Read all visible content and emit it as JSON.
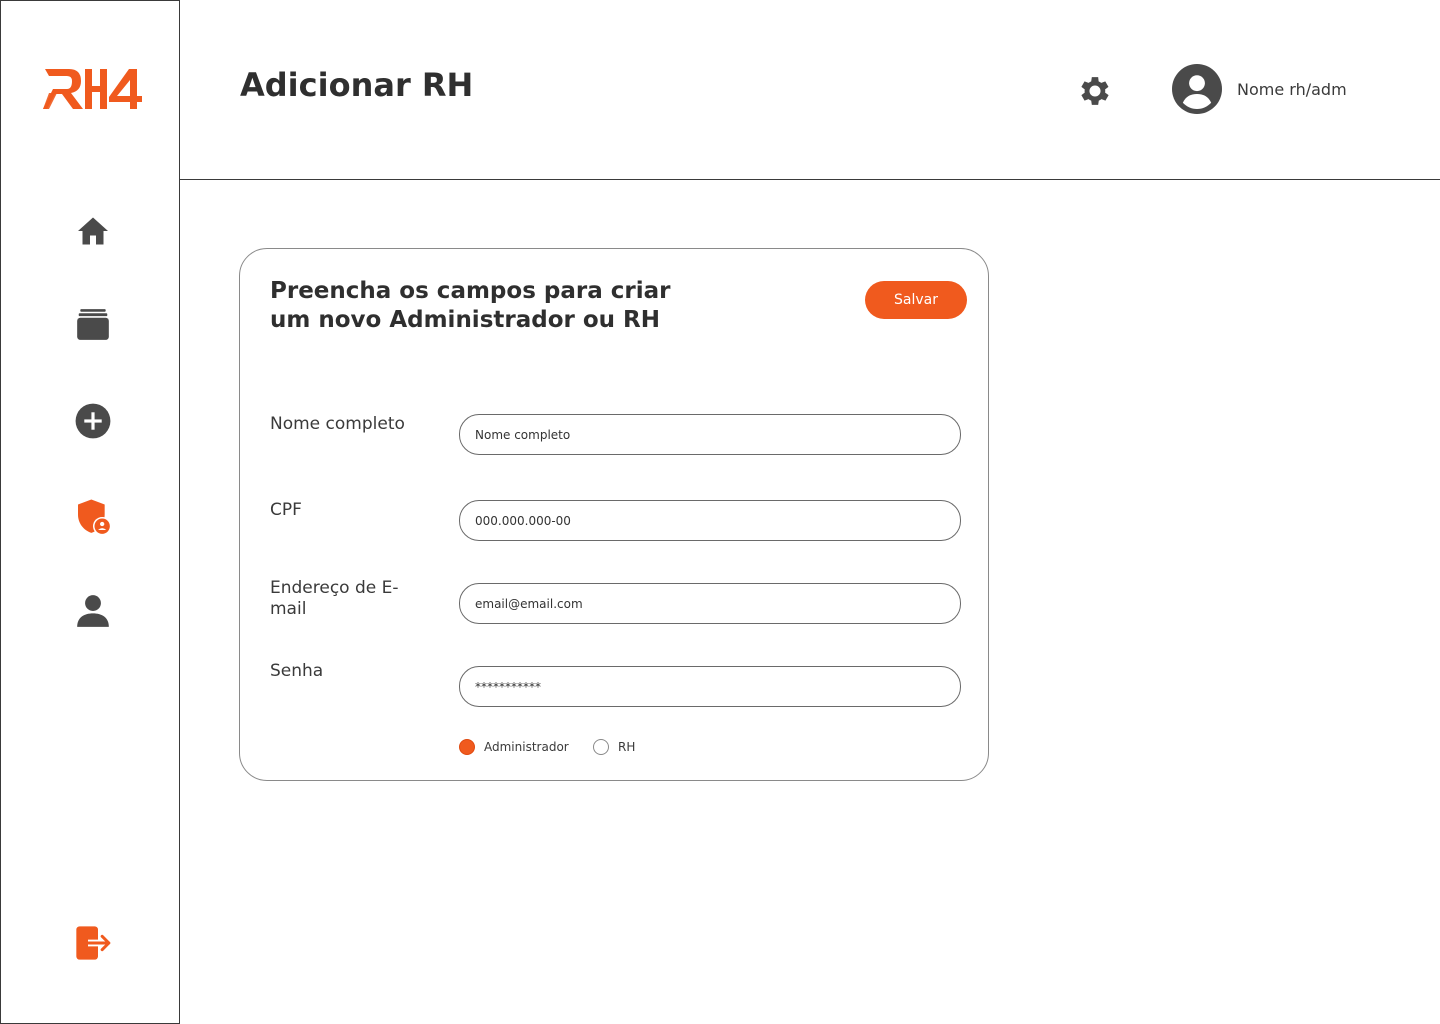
{
  "brand": {
    "logo_text": "RH4",
    "accent_color": "#f05a1e",
    "icon_color": "#4a4a4a"
  },
  "sidebar": {
    "items": [
      {
        "icon": "home-icon"
      },
      {
        "icon": "folder-icon"
      },
      {
        "icon": "add-circle-icon"
      },
      {
        "icon": "shield-user-icon",
        "active": true
      },
      {
        "icon": "user-icon"
      }
    ],
    "logout_icon": "logout-icon"
  },
  "header": {
    "title": "Adicionar RH",
    "settings_icon": "gear-icon",
    "user_name": "Nome rh/adm"
  },
  "form": {
    "heading": "Preencha os campos para criar um novo Administrador ou RH",
    "save_label": "Salvar",
    "fields": {
      "name": {
        "label": "Nome completo",
        "placeholder": "Nome completo"
      },
      "cpf": {
        "label": "CPF",
        "placeholder": "000.000.000-00"
      },
      "email": {
        "label": "Endereço de E-mail",
        "placeholder": "email@email.com"
      },
      "password": {
        "label": "Senha",
        "value": "***********"
      }
    },
    "role_options": [
      {
        "label": "Administrador",
        "selected": true
      },
      {
        "label": "RH",
        "selected": false
      }
    ]
  }
}
